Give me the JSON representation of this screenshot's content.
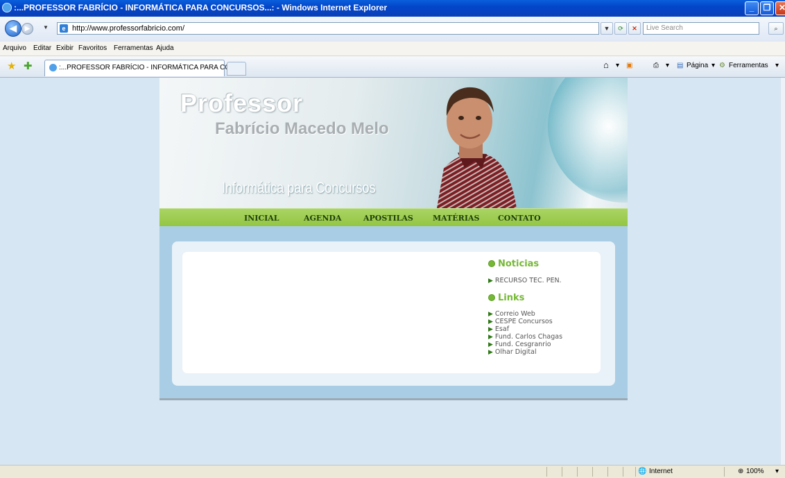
{
  "window": {
    "title": ":...PROFESSOR FABRÍCIO - INFORMÁTICA PARA CONCURSOS...: - Windows Internet Explorer",
    "buttons": [
      "_",
      "❐",
      "✕"
    ]
  },
  "address_bar": {
    "url": "http://www.professorfabricio.com/",
    "search_placeholder": "Live Search"
  },
  "menu": [
    "Arquivo",
    "Editar",
    "Exibir",
    "Favoritos",
    "Ferramentas",
    "Ajuda"
  ],
  "tab": {
    "label": ":...PROFESSOR FABRÍCIO - INFORMÁTICA PARA CO..."
  },
  "toolbar": {
    "pagina": "Página",
    "ferramentas": "Ferramentas"
  },
  "site": {
    "banner": {
      "professor": "Professor",
      "name": "Fabrício Macedo Melo",
      "subtitle": "Informática para Concursos"
    },
    "nav": [
      "INICIAL",
      "AGENDA",
      "APOSTILAS",
      "MATÉRIAS",
      "CONTATO"
    ],
    "noticias": {
      "title": "Noticias",
      "items": [
        "RECURSO TEC. PEN."
      ]
    },
    "links": {
      "title": "Links",
      "items": [
        "Correio Web",
        "CESPE Concursos",
        "Esaf",
        "Fund. Carlos Chagas",
        "Fund. Cesgranrio",
        "Olhar Digital"
      ]
    }
  },
  "status": {
    "zone": "Internet",
    "zoom": "100%"
  },
  "colors": {
    "accent_green": "#75b834",
    "nav_green": "#93c542",
    "body_blue": "#a9cde5",
    "page_bg": "#d6e6f3"
  }
}
